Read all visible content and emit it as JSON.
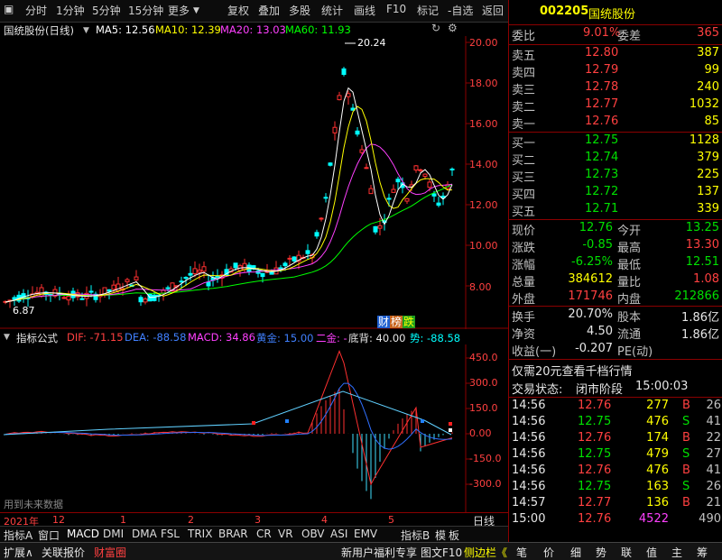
{
  "toolbar": {
    "items": [
      "分时",
      "1分钟",
      "5分钟",
      "15分钟",
      "更多",
      "复权",
      "叠加",
      "多股",
      "统计",
      "画线",
      "F10",
      "标记",
      "-自选",
      "返回"
    ]
  },
  "chart_header": {
    "name": "国统股份(日线)",
    "ma5": "MA5: 12.56",
    "ma10": "MA10: 12.39",
    "ma20": "MA20: 13.03",
    "ma60": "MA60: 11.93",
    "colors": {
      "ma5": "#ffffff",
      "ma10": "#ffff00",
      "ma20": "#ff40ff",
      "ma60": "#00ff00"
    }
  },
  "price_axis": [
    "20.00",
    "18.00",
    "16.00",
    "14.00",
    "12.00",
    "10.00",
    "8.00"
  ],
  "price_marks": {
    "high": "20.24",
    "low": "6.87"
  },
  "chip_tags": [
    "财",
    "榜",
    "跌"
  ],
  "indicator_header": {
    "name": "指标公式",
    "dif": "DIF: -71.15",
    "dea": "DEA: -88.58",
    "macd": "MACD: 34.86",
    "gold": "黄金: 15.00",
    "second": "二金: -",
    "bottom": "底背: 40.00",
    "trend": "势: -88.58"
  },
  "indicator_axis": [
    "450.0",
    "300.0",
    "150.0",
    "0.00",
    "-150.0",
    "-300.0"
  ],
  "future_data_note": "用到未来数据",
  "time_axis": {
    "labels": [
      "2021年",
      "12",
      "1",
      "2",
      "3",
      "4",
      "5"
    ],
    "period": "日线"
  },
  "bottom_tabs": [
    "指标A",
    "窗口",
    "MACD",
    "DMI",
    "DMA",
    "FSL",
    "TRIX",
    "BRAR",
    "CR",
    "VR",
    "OBV",
    "ASI",
    "EMV",
    "指标B",
    "模",
    "板"
  ],
  "stock": {
    "code": "002205",
    "name": "国统股份"
  },
  "order_ratio": {
    "label1": "委比",
    "value1": "9.01%",
    "label2": "委差",
    "value2": "365"
  },
  "asks": [
    {
      "label": "卖五",
      "price": "12.80",
      "vol": "387"
    },
    {
      "label": "卖四",
      "price": "12.79",
      "vol": "99"
    },
    {
      "label": "卖三",
      "price": "12.78",
      "vol": "240"
    },
    {
      "label": "卖二",
      "price": "12.77",
      "vol": "1032"
    },
    {
      "label": "卖一",
      "price": "12.76",
      "vol": "85"
    }
  ],
  "bids": [
    {
      "label": "买一",
      "price": "12.75",
      "vol": "1128"
    },
    {
      "label": "买二",
      "price": "12.74",
      "vol": "379"
    },
    {
      "label": "买三",
      "price": "12.73",
      "vol": "225"
    },
    {
      "label": "买四",
      "price": "12.72",
      "vol": "137"
    },
    {
      "label": "买五",
      "price": "12.71",
      "vol": "339"
    }
  ],
  "quote": [
    {
      "l1": "现价",
      "v1": "12.76",
      "l2": "今开",
      "v2": "13.25"
    },
    {
      "l1": "涨跌",
      "v1": "-0.85",
      "l2": "最高",
      "v2": "13.30"
    },
    {
      "l1": "涨幅",
      "v1": "-6.25%",
      "l2": "最低",
      "v2": "12.51"
    },
    {
      "l1": "总量",
      "v1": "384612",
      "l2": "量比",
      "v2": "1.08"
    },
    {
      "l1": "外盘",
      "v1": "171746",
      "l2": "内盘",
      "v2": "212866"
    }
  ],
  "fundamentals": [
    {
      "l1": "换手",
      "v1": "20.70%",
      "l2": "股本",
      "v2": "1.86亿"
    },
    {
      "l1": "净资",
      "v1": "4.50",
      "l2": "流通",
      "v2": "1.86亿"
    },
    {
      "l1": "收益(一)",
      "v1": "-0.207",
      "l2": "PE(动)",
      "v2": ""
    }
  ],
  "promo": "仅需20元查看千档行情",
  "trade_status": {
    "label": "交易状态:",
    "value": "闭市阶段",
    "time": "15:00:03"
  },
  "ticks": [
    {
      "time": "14:56",
      "price": "12.76",
      "vol": "277",
      "side": "B",
      "n": "26"
    },
    {
      "time": "14:56",
      "price": "12.75",
      "vol": "476",
      "side": "S",
      "n": "41"
    },
    {
      "time": "14:56",
      "price": "12.76",
      "vol": "174",
      "side": "B",
      "n": "22"
    },
    {
      "time": "14:56",
      "price": "12.75",
      "vol": "479",
      "side": "S",
      "n": "27"
    },
    {
      "time": "14:56",
      "price": "12.76",
      "vol": "476",
      "side": "B",
      "n": "41"
    },
    {
      "time": "14:56",
      "price": "12.75",
      "vol": "163",
      "side": "S",
      "n": "26"
    },
    {
      "time": "14:57",
      "price": "12.77",
      "vol": "136",
      "side": "B",
      "n": "21"
    },
    {
      "time": "15:00",
      "price": "12.76",
      "vol": "4522",
      "side": "",
      "n": "490"
    }
  ],
  "status_bar": {
    "left": [
      "扩展∧",
      "关联报价",
      "财富圈"
    ],
    "middle": [
      "新用户福利专享",
      "图文F10",
      "侧边栏《"
    ],
    "right": [
      "笔",
      "价",
      "细",
      "势",
      "联",
      "值",
      "主",
      "筹"
    ]
  }
}
